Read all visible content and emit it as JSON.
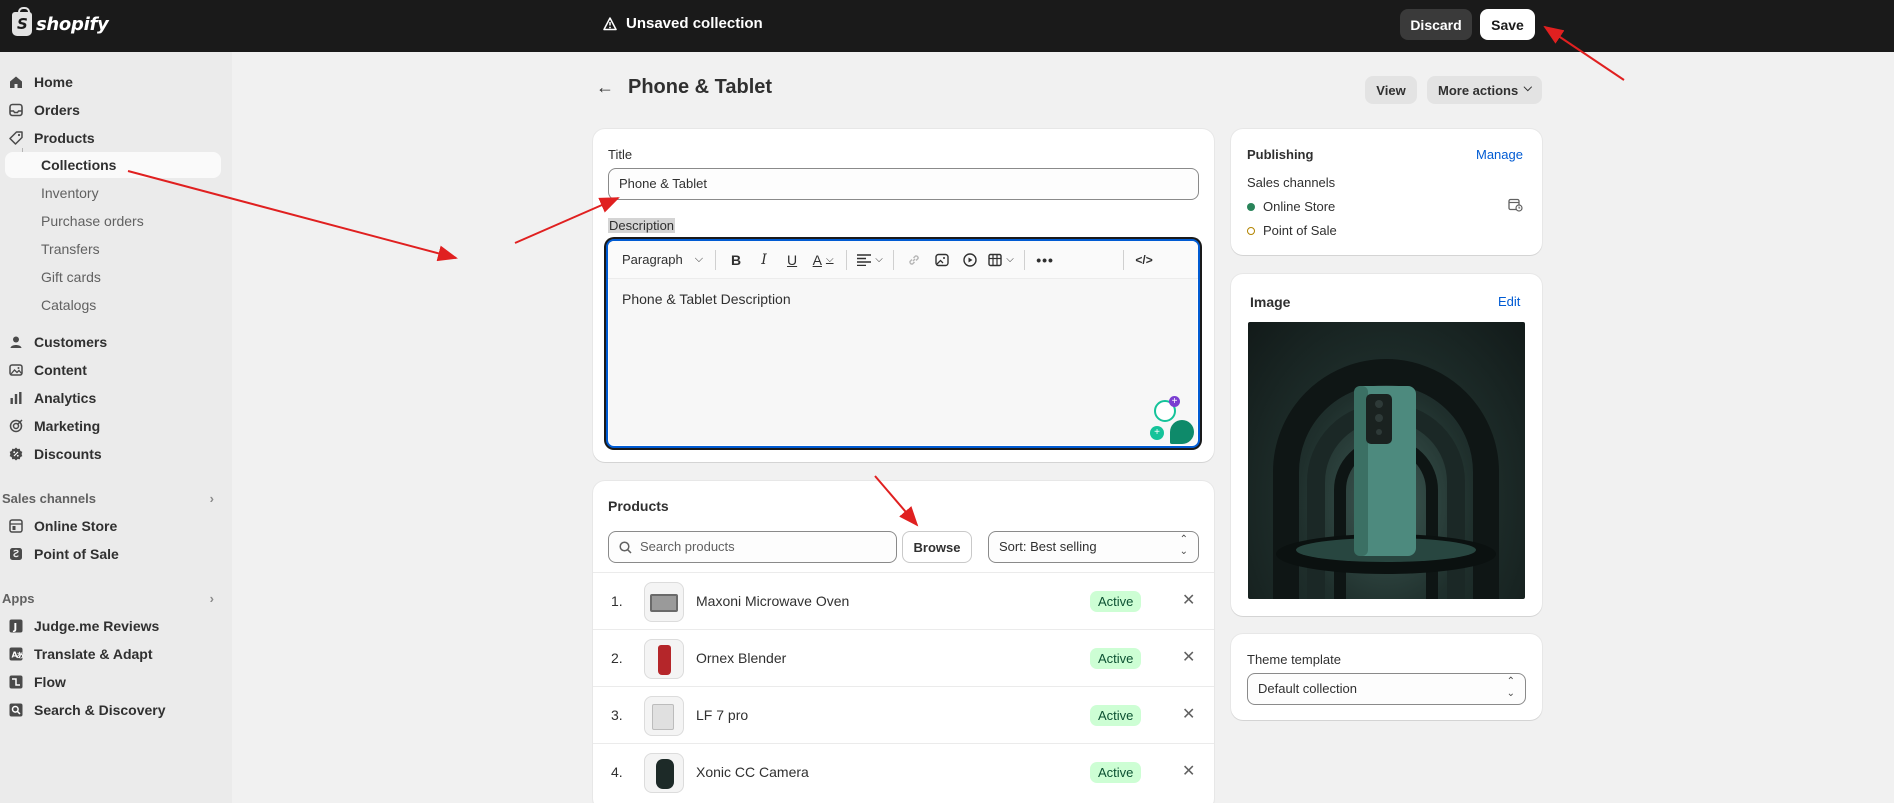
{
  "topbar": {
    "logo_text": "shopify",
    "status": "Unsaved collection",
    "discard_label": "Discard",
    "save_label": "Save"
  },
  "sidebar": {
    "items": [
      {
        "label": "Home",
        "icon": "home-icon"
      },
      {
        "label": "Orders",
        "icon": "inbox-icon"
      },
      {
        "label": "Products",
        "icon": "tag-icon"
      },
      {
        "label": "Collections",
        "icon": ""
      },
      {
        "label": "Inventory",
        "icon": ""
      },
      {
        "label": "Purchase orders",
        "icon": ""
      },
      {
        "label": "Transfers",
        "icon": ""
      },
      {
        "label": "Gift cards",
        "icon": ""
      },
      {
        "label": "Catalogs",
        "icon": ""
      },
      {
        "label": "Customers",
        "icon": "person-icon"
      },
      {
        "label": "Content",
        "icon": "image-icon"
      },
      {
        "label": "Analytics",
        "icon": "bar-chart-icon"
      },
      {
        "label": "Marketing",
        "icon": "target-icon"
      },
      {
        "label": "Discounts",
        "icon": "discount-icon"
      }
    ],
    "sales_channels_label": "Sales channels",
    "sales_channels": [
      {
        "label": "Online Store",
        "icon": "store-icon"
      },
      {
        "label": "Point of Sale",
        "icon": "pos-icon"
      }
    ],
    "apps_label": "Apps",
    "apps": [
      {
        "label": "Judge.me Reviews",
        "icon": "judgeme-icon"
      },
      {
        "label": "Translate & Adapt",
        "icon": "translate-icon"
      },
      {
        "label": "Flow",
        "icon": "flow-icon"
      },
      {
        "label": "Search & Discovery",
        "icon": "search-discovery-icon"
      }
    ]
  },
  "header": {
    "title": "Phone & Tablet",
    "view_label": "View",
    "more_actions_label": "More actions"
  },
  "main": {
    "title_label": "Title",
    "title_value": "Phone & Tablet",
    "description_label": "Description",
    "toolbar_paragraph": "Paragraph",
    "description_value": "Phone & Tablet Description"
  },
  "products": {
    "heading": "Products",
    "search_placeholder": "Search products",
    "browse_label": "Browse",
    "sort_label": "Sort: Best selling",
    "rows": [
      {
        "num": "1.",
        "name": "Maxoni Microwave Oven",
        "status": "Active"
      },
      {
        "num": "2.",
        "name": "Ornex Blender",
        "status": "Active"
      },
      {
        "num": "3.",
        "name": "LF 7 pro",
        "status": "Active"
      },
      {
        "num": "4.",
        "name": "Xonic CC Camera",
        "status": "Active"
      }
    ]
  },
  "publishing": {
    "heading": "Publishing",
    "manage_label": "Manage",
    "sales_channels_label": "Sales channels",
    "channels": [
      {
        "label": "Online Store",
        "status_color": "#29845a"
      },
      {
        "label": "Point of Sale",
        "status_color": "#b28400"
      }
    ]
  },
  "image_card": {
    "heading": "Image",
    "edit_label": "Edit"
  },
  "theme": {
    "label": "Theme template",
    "value": "Default collection"
  },
  "colors": {
    "accent": "#005bd3",
    "topbar": "#1a1a1a",
    "active_badge": "#cdfed4",
    "annotation_arrow": "#e02020"
  }
}
